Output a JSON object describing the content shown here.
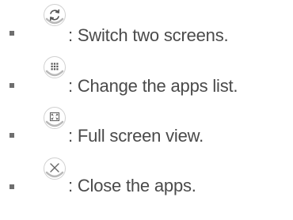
{
  "list": {
    "items": [
      {
        "icon": "switch-screens-icon",
        "separator": ": ",
        "text": "Switch two screens."
      },
      {
        "icon": "apps-grid-icon",
        "separator": ": ",
        "text": "Change the apps list."
      },
      {
        "icon": "full-screen-icon",
        "separator": ": ",
        "text": "Full screen view."
      },
      {
        "icon": "close-icon",
        "separator": ": ",
        "text": "Close the apps."
      }
    ]
  }
}
